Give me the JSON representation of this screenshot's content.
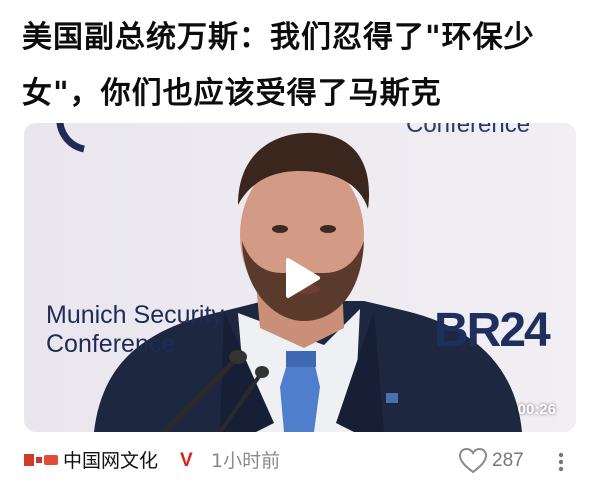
{
  "article": {
    "headline": "美国副总统万斯：我们忍得了\"环保少女\"，你们也应该受得了马斯克"
  },
  "video": {
    "background_text_left": "Munich Security\nConference",
    "background_text_top": "Conference",
    "broadcaster_logo": "BR24",
    "duration": "00:26"
  },
  "footer": {
    "source_name": "中国网文化",
    "verified_badge": "V",
    "time_ago": "1小时前",
    "like_count": "287"
  },
  "colors": {
    "verified": "#e0201c",
    "tie": "#4f7fcc",
    "suit": "#1d2740"
  }
}
